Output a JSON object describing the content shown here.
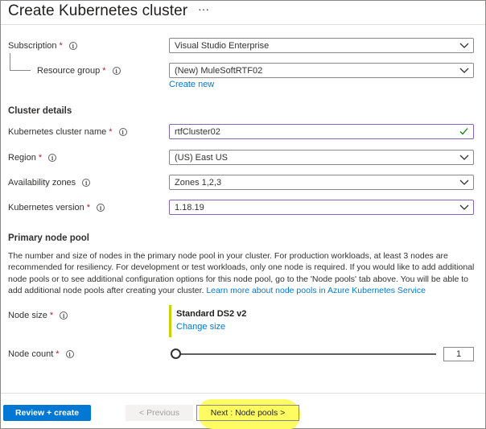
{
  "page": {
    "title": "Create Kubernetes cluster",
    "more": "···"
  },
  "project": {
    "subscription_label": "Subscription",
    "subscription_value": "Visual Studio Enterprise",
    "resource_group_label": "Resource group",
    "resource_group_value": "(New) MuleSoftRTF02",
    "create_new": "Create new"
  },
  "cluster": {
    "heading": "Cluster details",
    "name_label": "Kubernetes cluster name",
    "name_value": "rtfCluster02",
    "region_label": "Region",
    "region_value": "(US) East US",
    "zones_label": "Availability zones",
    "zones_value": "Zones 1,2,3",
    "version_label": "Kubernetes version",
    "version_value": "1.18.19"
  },
  "pool": {
    "heading": "Primary node pool",
    "description": "The number and size of nodes in the primary node pool in your cluster. For production workloads, at least 3 nodes are recommended for resiliency. For development or test workloads, only one node is required. If you would like to add additional node pools or to see additional configuration options for this node pool, go to the 'Node pools' tab above. You will be able to add additional node pools after creating your cluster.",
    "learn_more": "Learn more about node pools in Azure Kubernetes Service",
    "size_label": "Node size",
    "size_value": "Standard DS2 v2",
    "change_size": "Change size",
    "count_label": "Node count",
    "count_value": "1",
    "count_slider_level": 0
  },
  "footer": {
    "review_create": "Review + create",
    "previous": "< Previous",
    "next": "Next : Node pools >"
  },
  "markers": {
    "required": "*",
    "info": "i"
  },
  "colors": {
    "accent": "#0078d4",
    "required": "#a4262c",
    "focus_border": "#8764b8",
    "valid_check": "#107c10",
    "highlight": "#fffc62"
  }
}
